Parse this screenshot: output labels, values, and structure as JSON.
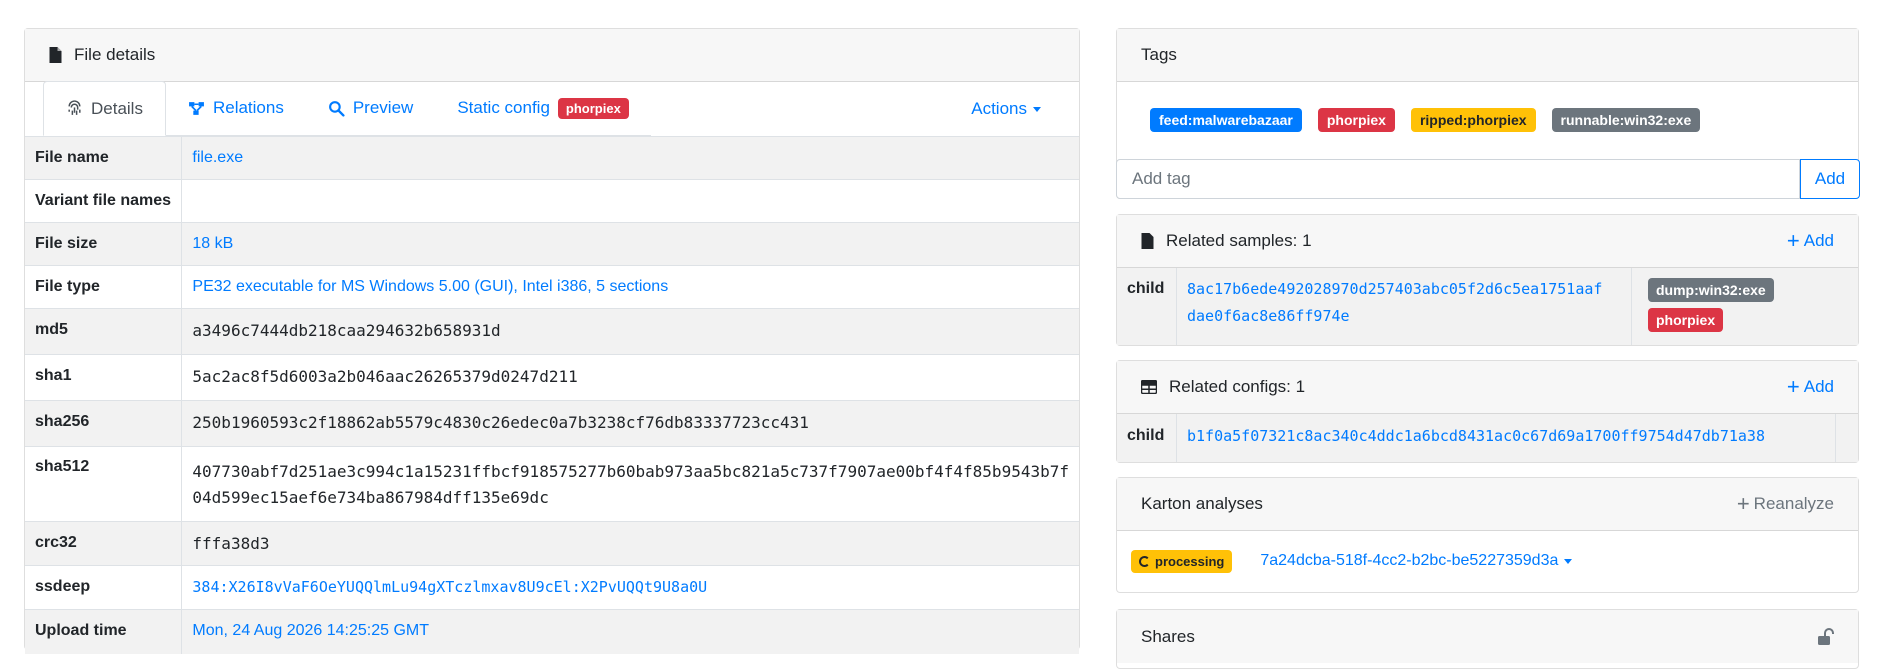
{
  "file_details": {
    "header": "File details",
    "tabs": [
      {
        "label": "Details"
      },
      {
        "label": "Relations"
      },
      {
        "label": "Preview"
      },
      {
        "label": "Static config",
        "badge": "phorpiex"
      }
    ],
    "actions_label": "Actions",
    "rows": [
      {
        "key": "File name",
        "value": "file.exe"
      },
      {
        "key": "Variant file names",
        "value": ""
      },
      {
        "key": "File size",
        "value": "18 kB"
      },
      {
        "key": "File type",
        "value": "PE32 executable for MS Windows 5.00 (GUI), Intel i386, 5 sections"
      },
      {
        "key": "md5",
        "value": "a3496c7444db218caa294632b658931d"
      },
      {
        "key": "sha1",
        "value": "5ac2ac8f5d6003a2b046aac26265379d0247d211"
      },
      {
        "key": "sha256",
        "value": "250b1960593c2f18862ab5579c4830c26edec0a7b3238cf76db83337723cc431"
      },
      {
        "key": "sha512",
        "value_line1": "407730abf7d251ae3c994c1a15231ffbcf918575277b60bab973aa5bc821a5c737f7907ae00bf4f4f85b9543b7f",
        "value_line2": "04d599ec15aef6e734ba867984dff135e69dc"
      },
      {
        "key": "crc32",
        "value": "fffa38d3"
      },
      {
        "key": "ssdeep",
        "value": "384:X26I8vVaF6OeYUQQlmLu94gXTczlmxav8U9cEl:X2PvUQQt9U8a0U"
      },
      {
        "key": "Upload time",
        "value": "Mon, 24 Aug 2026 14:25:25 GMT"
      }
    ]
  },
  "tags": {
    "header": "Tags",
    "items": [
      "feed:malwarebazaar",
      "phorpiex",
      "ripped:phorpiex",
      "runnable:win32:exe"
    ],
    "colors": [
      "#007bff",
      "#dc3545",
      "#ffc107",
      "#6c757d"
    ],
    "input_placeholder": "Add tag",
    "add_label": "Add"
  },
  "related_samples": {
    "header": "Related samples: 1",
    "add_label": "Add",
    "row": {
      "key": "child",
      "hash_line1": "8ac17b6ede492028970d257403abc05f2d6c5ea1751aaf",
      "hash_line2": "dae0f6ac8e86ff974e",
      "tags": [
        "dump:win32:exe",
        "phorpiex"
      ]
    }
  },
  "related_configs": {
    "header": "Related configs: 1",
    "add_label": "Add",
    "row": {
      "key": "child",
      "hash": "b1f0a5f07321c8ac340c4ddc1a6bcd8431ac0c67d69a1700ff9754d47db71a38"
    }
  },
  "karton": {
    "header": "Karton analyses",
    "reanalyze_label": "Reanalyze",
    "status": "processing",
    "analysis_id": "7a24dcba-518f-4cc2-b2bc-be5227359d3a"
  },
  "shares": {
    "header": "Shares"
  }
}
